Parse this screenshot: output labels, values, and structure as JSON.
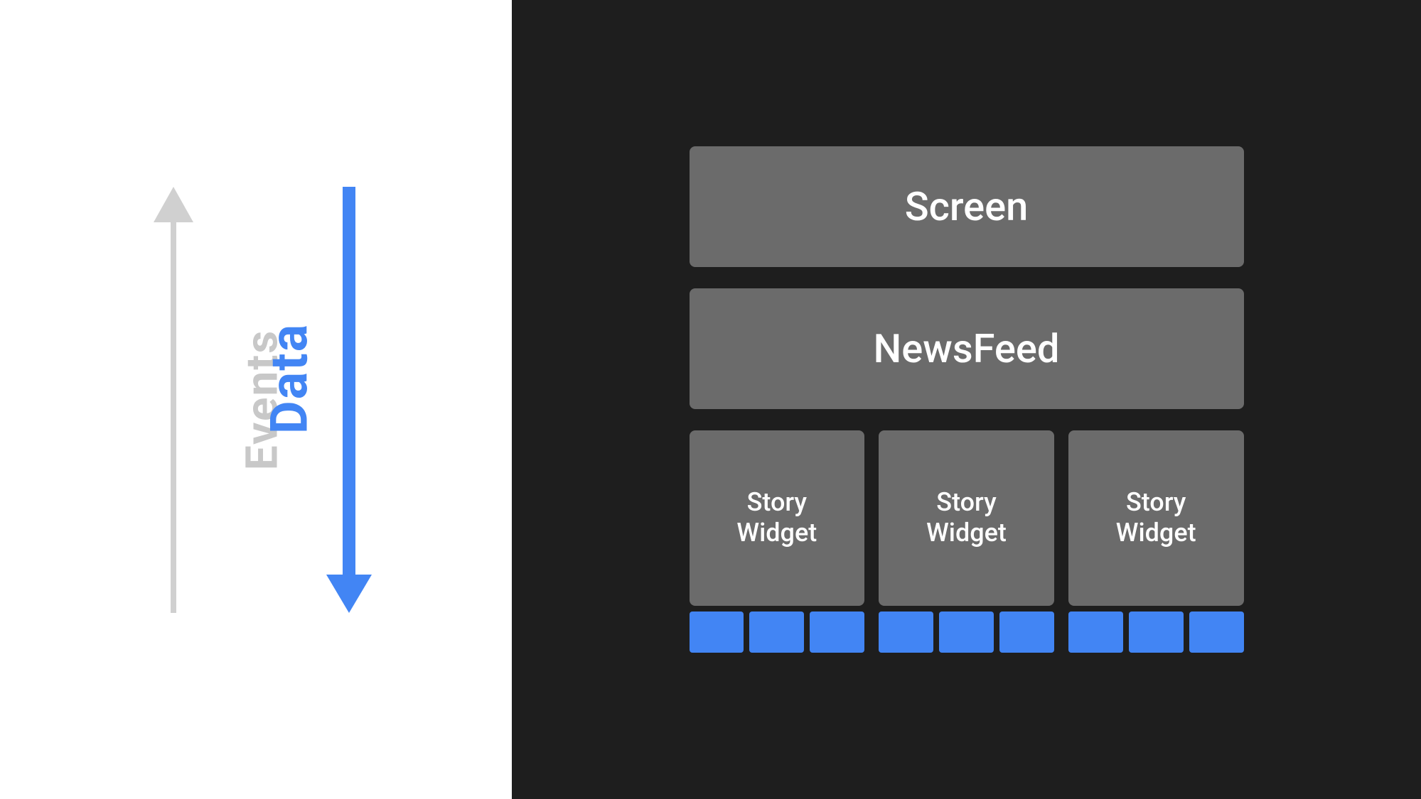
{
  "left": {
    "events_label": "Events",
    "data_label": "Data"
  },
  "right": {
    "screen_label": "Screen",
    "newsfeed_label": "NewsFeed",
    "story_widgets": [
      {
        "label": "Story\nWidget"
      },
      {
        "label": "Story\nWidget"
      },
      {
        "label": "Story\nWidget"
      }
    ]
  },
  "colors": {
    "blue": "#4285f4",
    "dark_bg": "#1e1e1e",
    "white_bg": "#ffffff",
    "gray_box": "#6b6b6b",
    "gray_arrow": "#d0d0d0"
  }
}
